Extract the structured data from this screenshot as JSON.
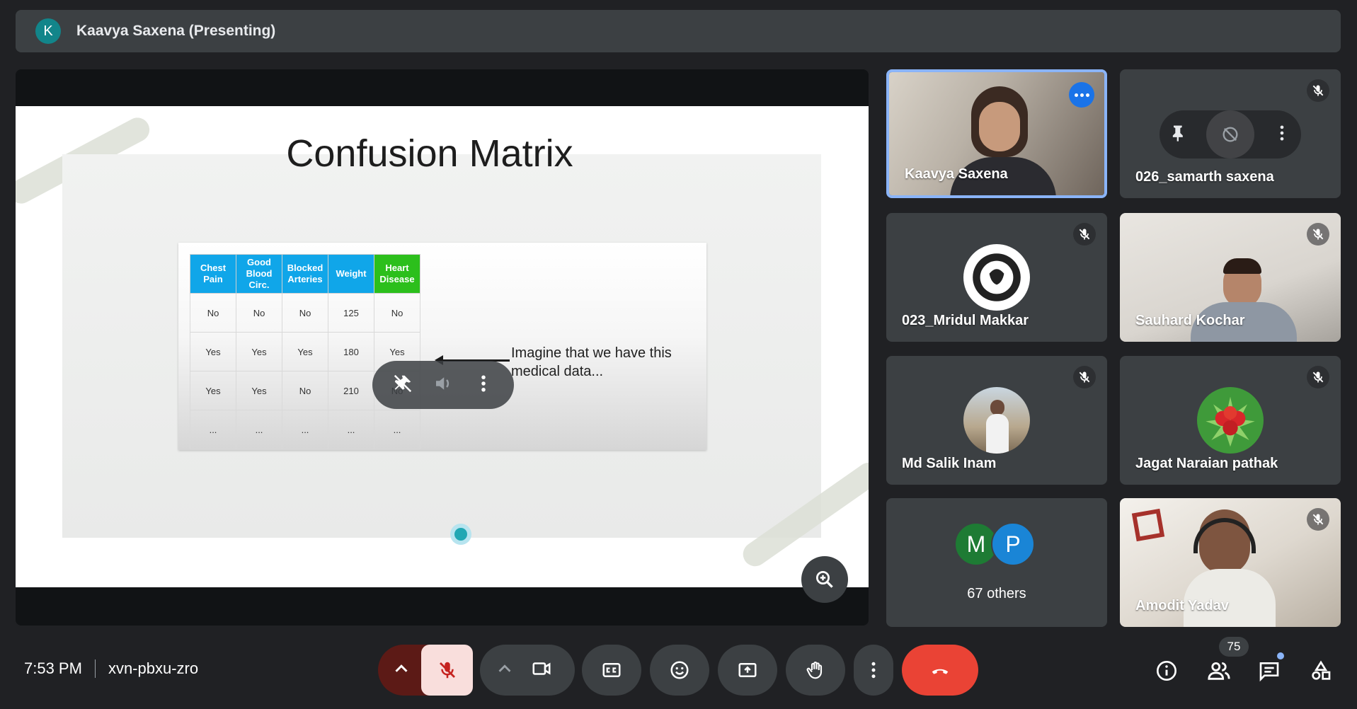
{
  "top_bar": {
    "avatar_letter": "K",
    "title": "Kaavya Saxena (Presenting)"
  },
  "slide": {
    "title": "Confusion Matrix",
    "table": {
      "headers": [
        [
          "Chest",
          "Pain"
        ],
        [
          "Good",
          "Blood",
          "Circ."
        ],
        [
          "Blocked",
          "Arteries"
        ],
        [
          "Weight"
        ],
        [
          "Heart",
          "Disease"
        ]
      ],
      "rows": [
        [
          "No",
          "No",
          "No",
          "125",
          "No"
        ],
        [
          "Yes",
          "Yes",
          "Yes",
          "180",
          "Yes"
        ],
        [
          "Yes",
          "Yes",
          "No",
          "210",
          "No"
        ],
        [
          "...",
          "...",
          "...",
          "...",
          "..."
        ]
      ]
    },
    "caption": "Imagine that we have this\nmedical data..."
  },
  "participants": [
    {
      "name": "Kaavya Saxena",
      "muted": false,
      "active": true
    },
    {
      "name": "026_samarth saxena",
      "muted": true
    },
    {
      "name": "023_Mridul Makkar",
      "muted": true
    },
    {
      "name": "Sauhard Kochar",
      "muted": true
    },
    {
      "name": "Md Salik Inam",
      "muted": true
    },
    {
      "name": "Jagat Naraian pathak",
      "muted": true
    },
    {
      "name": "Amodit Yadav",
      "muted": true
    }
  ],
  "others": {
    "avatars": [
      {
        "letter": "M",
        "color": "#1e7b34"
      },
      {
        "letter": "P",
        "color": "#1a85d6"
      }
    ],
    "label": "67 others"
  },
  "bottom_bar": {
    "time": "7:53 PM",
    "meeting_code": "xvn-pbxu-zro",
    "participant_count": "75"
  },
  "colors": {
    "background": "#202124",
    "surface": "#3c4043",
    "end_call": "#ea4335",
    "muted_mic_bg": "#f9dedc",
    "active_border": "#8ab4f8"
  }
}
